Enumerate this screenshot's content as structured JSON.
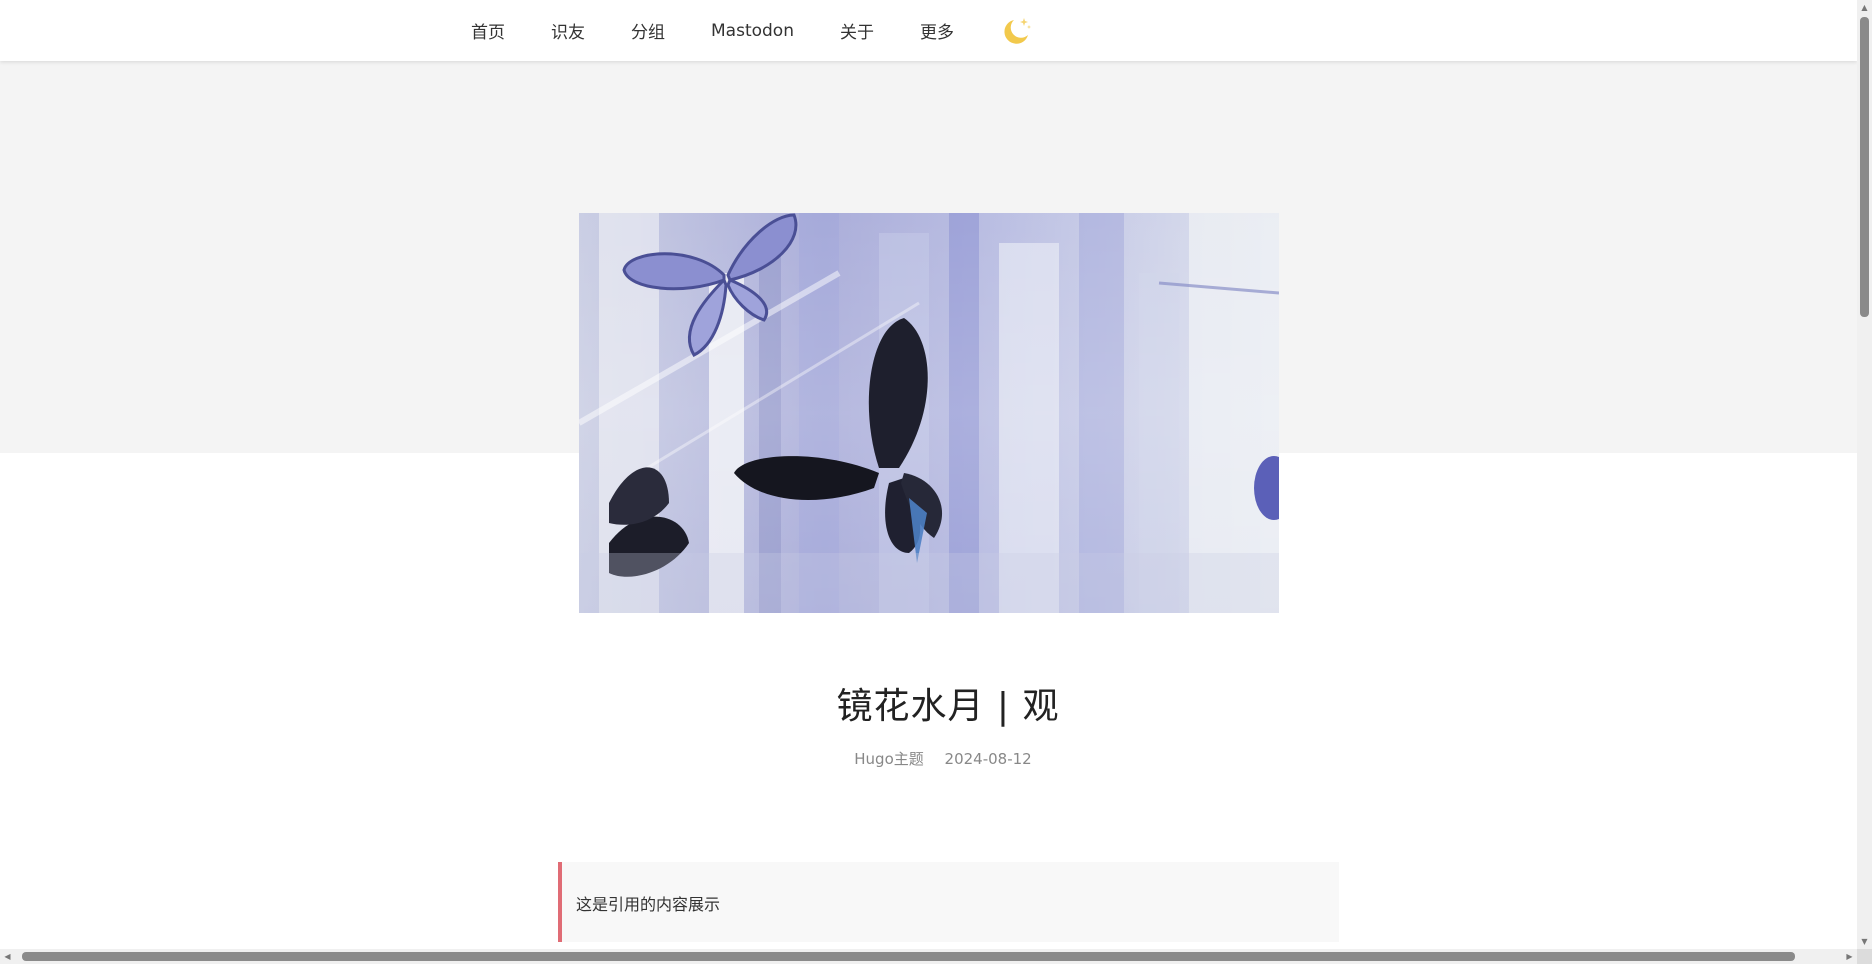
{
  "nav": {
    "items": [
      {
        "label": "首页"
      },
      {
        "label": "识友"
      },
      {
        "label": "分组"
      },
      {
        "label": "Mastodon"
      },
      {
        "label": "关于"
      },
      {
        "label": "更多"
      }
    ],
    "theme_icon": "moon-icon"
  },
  "colors": {
    "moon": "#f2c94c",
    "quote_border": "#e06c75",
    "hero_band": "#f4f4f4"
  },
  "post": {
    "cover_icon": "butterfly-painting-image",
    "title": "镜花水月 | 观",
    "category": "Hugo主题",
    "date": "2024-08-12"
  },
  "quote": {
    "text": "这是引用的内容展示"
  },
  "scrollbars": {
    "vertical_icon": "scroll-arrow-icon",
    "horizontal_icon": "scroll-arrow-icon"
  }
}
